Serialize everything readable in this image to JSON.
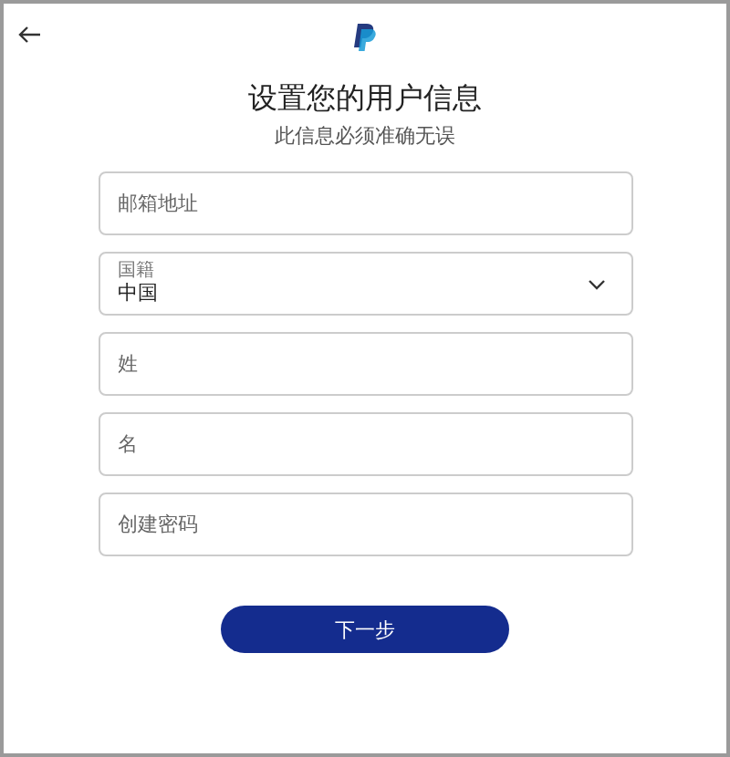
{
  "title": "设置您的用户信息",
  "subtitle": "此信息必须准确无误",
  "fields": [
    {
      "kind": "input",
      "placeholder": "邮箱地址"
    },
    {
      "kind": "select",
      "label": "国籍",
      "value": "中国"
    },
    {
      "kind": "input",
      "placeholder": "姓"
    },
    {
      "kind": "input",
      "placeholder": "名"
    },
    {
      "kind": "input",
      "placeholder": "创建密码"
    }
  ],
  "button": "下一步"
}
